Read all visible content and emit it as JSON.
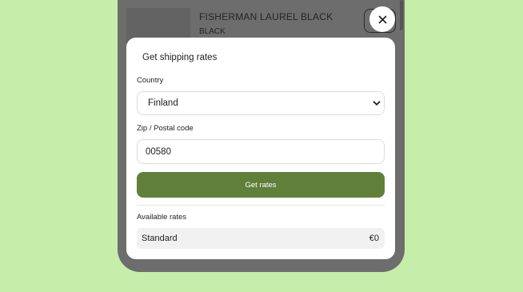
{
  "background_product": {
    "title": "FISHERMAN LAUREL BLACK",
    "variant": "BLACK"
  },
  "close_icon": "close-icon",
  "modal": {
    "title": "Get shipping rates",
    "country_label": "Country",
    "country_value": "Finland",
    "zip_label": "Zip / Postal code",
    "zip_value": "00580",
    "get_rates_label": "Get rates",
    "available_rates_label": "Available rates",
    "rates": [
      {
        "name": "Standard",
        "price": "€0"
      }
    ]
  },
  "colors": {
    "page_background": "#c6eda9",
    "accent_button": "#5f7f3b",
    "overlay": "#6d6d6d"
  }
}
